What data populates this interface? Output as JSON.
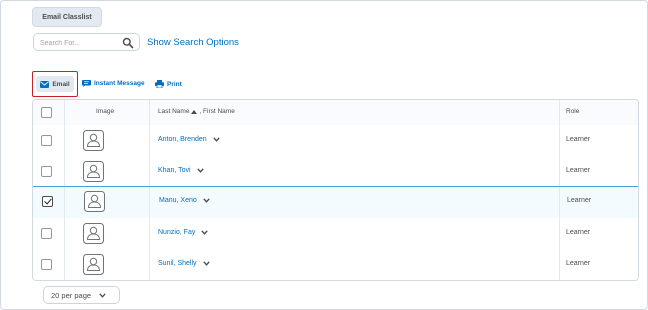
{
  "toolbar_top": {
    "email_classlist": "Email Classlist"
  },
  "search": {
    "placeholder": "Search For...",
    "value": "",
    "show_options": "Show Search Options"
  },
  "actions": {
    "email": "Email",
    "instant_message": "Instant Message",
    "print": "Print"
  },
  "table": {
    "col_image": "Image",
    "col_name": "Last Name",
    "col_name_sep": ", First Name",
    "col_role": "Role",
    "rows": [
      {
        "name": "Anton, Brenden",
        "role": "Learner",
        "checked": false
      },
      {
        "name": "Khan, Tovi",
        "role": "Learner",
        "checked": false
      },
      {
        "name": "Manu, Xeno",
        "role": "Learner",
        "checked": true
      },
      {
        "name": "Nunzio, Fay",
        "role": "Learner",
        "checked": false
      },
      {
        "name": "Sunil, Shelly",
        "role": "Learner",
        "checked": false
      }
    ]
  },
  "pager": {
    "per_page": "20 per page"
  },
  "colors": {
    "link": "#006fbf",
    "selected_border": "#46a5e0",
    "focus_outline": "#cd2026"
  }
}
